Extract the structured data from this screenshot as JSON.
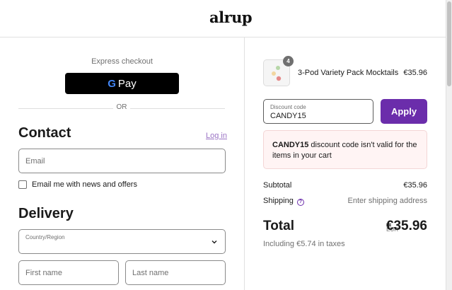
{
  "header": {
    "logo": "alrup"
  },
  "express": {
    "label": "Express checkout",
    "gpay_g": "G",
    "gpay_text": "Pay",
    "or": "OR"
  },
  "contact": {
    "title": "Contact",
    "login": "Log in",
    "email_placeholder": "Email",
    "newsletter_label": "Email me with news and offers",
    "newsletter_checked": false
  },
  "delivery": {
    "title": "Delivery",
    "country_label": "Country/Region",
    "first_name_placeholder": "First name",
    "last_name_placeholder": "Last name"
  },
  "cart": {
    "product": {
      "name": "3-Pod Variety Pack Mocktails",
      "price": "€35.96",
      "quantity": "4"
    },
    "discount_label": "Discount code",
    "discount_value": "CANDY15",
    "apply_label": "Apply",
    "error_code": "CANDY15",
    "error_message": " discount code isn't valid for the items in your cart",
    "subtotal_label": "Subtotal",
    "subtotal_value": "€35.96",
    "shipping_label": "Shipping",
    "shipping_value": "Enter shipping address",
    "help_glyph": "?",
    "total_label": "Total",
    "currency": "EUR",
    "total_value": "€35.96",
    "taxes": "Including €5.74 in taxes"
  },
  "colors": {
    "accent": "#6b2dab",
    "error_bg": "#fff4f4",
    "link": "#9a73c4"
  }
}
